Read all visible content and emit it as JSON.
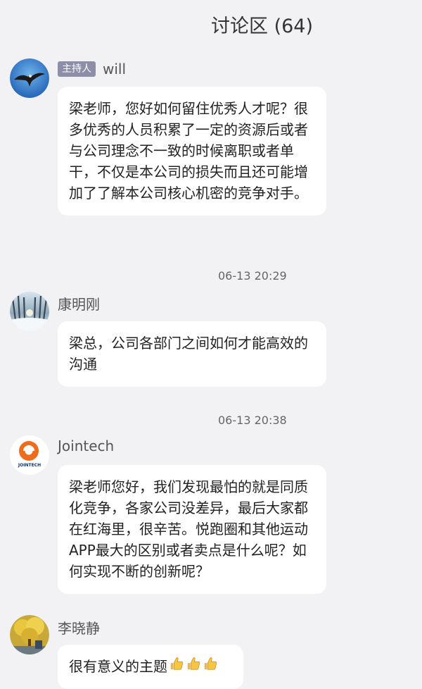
{
  "header": {
    "title": "讨论区 (64)"
  },
  "messages": [
    {
      "username": "will",
      "badge": "主持人",
      "avatar": "eagle-avatar",
      "text": "梁老师，您好如何留住优秀人才呢？很多优秀的人员积累了一定的资源后或者与公司理念不一致的时候离职或者单干，不仅是本公司的损失而且还可能增加了了解本公司核心机密的竞争对手。"
    },
    {
      "timestamp": "06-13 20:29",
      "username": "康明刚",
      "avatar": "snowy-forest-avatar",
      "text": "梁总，公司各部门之间如何才能高效的沟通"
    },
    {
      "timestamp": "06-13 20:38",
      "username": "Jointech",
      "avatar": "jointech-logo",
      "avatar_logo_text": "JOINTECH",
      "text": "梁老师您好，我们发现最怕的就是同质化竞争，各家公司没差异，最后大家都在红海里，很辛苦。悦跑圈和其他运动APP最大的区别或者卖点是什么呢？如何实现不断的创新呢？"
    },
    {
      "username": "李晓静",
      "avatar": "yellow-tree-avatar",
      "text": "很有意义的主题",
      "emoji": [
        "thumbs-up-emoji",
        "thumbs-up-emoji",
        "thumbs-up-emoji"
      ]
    }
  ],
  "colors": {
    "background": "#f2f2f5",
    "bubble": "#ffffff",
    "badge": "#8e8ea8",
    "jointech_orange": "#ee6c1a"
  }
}
